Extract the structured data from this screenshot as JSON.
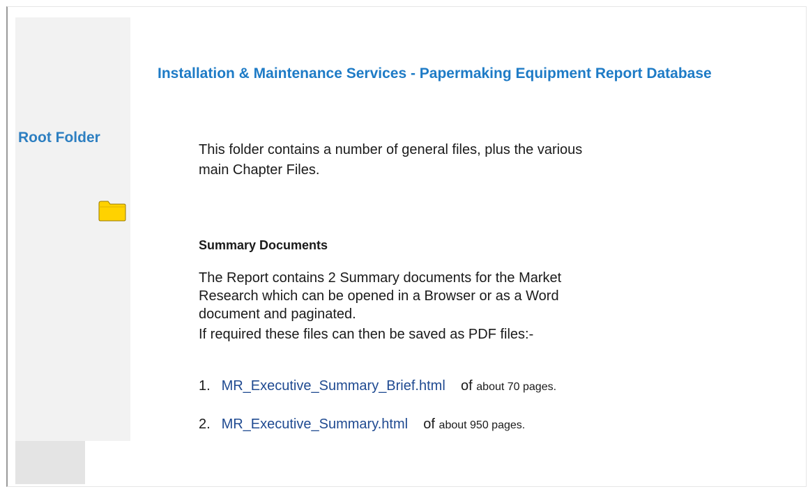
{
  "header": {
    "title": "Installation & Maintenance Services - Papermaking Equipment Report Database"
  },
  "sidebar": {
    "folder_label": "Root Folder",
    "folder_icon": "folder-icon",
    "folder_icon_color": "#FFD200"
  },
  "main": {
    "intro": "This folder contains a number of general files, plus the various main Chapter Files.",
    "summary_heading": "Summary Documents",
    "summary_text": "The Report contains 2 Summary documents for the Market Research which can be opened in a Browser or as a Word document and paginated.",
    "pdf_note": "If required these files can then be saved as PDF files:-",
    "documents": [
      {
        "number": "1.",
        "link": "MR_Executive_Summary_Brief.html",
        "of": "of",
        "pages": "about 70 pages."
      },
      {
        "number": "2.",
        "link": "MR_Executive_Summary.html",
        "of": "of",
        "pages": "about 950 pages."
      }
    ]
  },
  "colors": {
    "title_blue": "#1E7BC6",
    "folder_label_blue": "#2D7FC1",
    "link_blue": "#1F4A91",
    "sidebar_gray": "#F2F2F2"
  }
}
